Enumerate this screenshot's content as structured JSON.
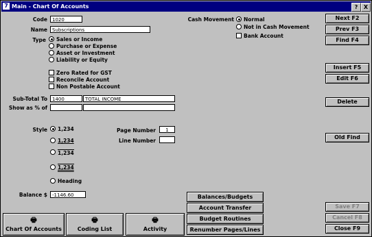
{
  "window": {
    "title": "Main - Chart Of Accounts",
    "help_glyph": "?",
    "close_glyph": "X",
    "app_glyph": "7"
  },
  "form": {
    "code_label": "Code",
    "code_value": "1020",
    "name_label": "Name",
    "name_value": "Subscriptions",
    "type_label": "Type",
    "type_options": [
      "Sales or Income",
      "Purchase or Expense",
      "Asset or Investment",
      "Liability or Equity"
    ],
    "type_selected": 0,
    "checkboxes": [
      "Zero Rated for GST",
      "Reconcile Account",
      "Non Postable Account"
    ],
    "subtotal_label": "Sub-Total To",
    "subtotal_code": "1400",
    "subtotal_name": "TOTAL  INCOME",
    "show_pct_label": "Show as % of",
    "show_pct_code": "",
    "show_pct_name": "",
    "style_label": "Style",
    "style_options": [
      "1,234",
      "1,234",
      "1,234",
      "1,234",
      "Heading"
    ],
    "style_selected": 0,
    "page_number_label": "Page Number",
    "page_number_value": "1",
    "line_number_label": "Line Number",
    "line_number_value": "",
    "balance_label": "Balance $",
    "balance_value": "-1146.60",
    "cash_movement_label": "Cash Movement",
    "cash_options": [
      "Normal",
      "Not in Cash Movement"
    ],
    "cash_selected": 0,
    "bank_account_label": "Bank Account"
  },
  "right_buttons": {
    "next": "Next F2",
    "prev": "Prev F3",
    "find": "Find F4",
    "insert": "Insert F5",
    "edit": "Edit F6",
    "delete": "Delete",
    "old_find": "Old Find",
    "save": "Save F7",
    "cancel": "Cancel F8",
    "close": "Close F9"
  },
  "middle_buttons": [
    "Balances/Budgets",
    "Account Transfer",
    "Budget Routines",
    "Renumber Pages/Lines"
  ],
  "bottom_buttons": [
    "Chart Of Accounts",
    "Coding List",
    "Activity"
  ]
}
